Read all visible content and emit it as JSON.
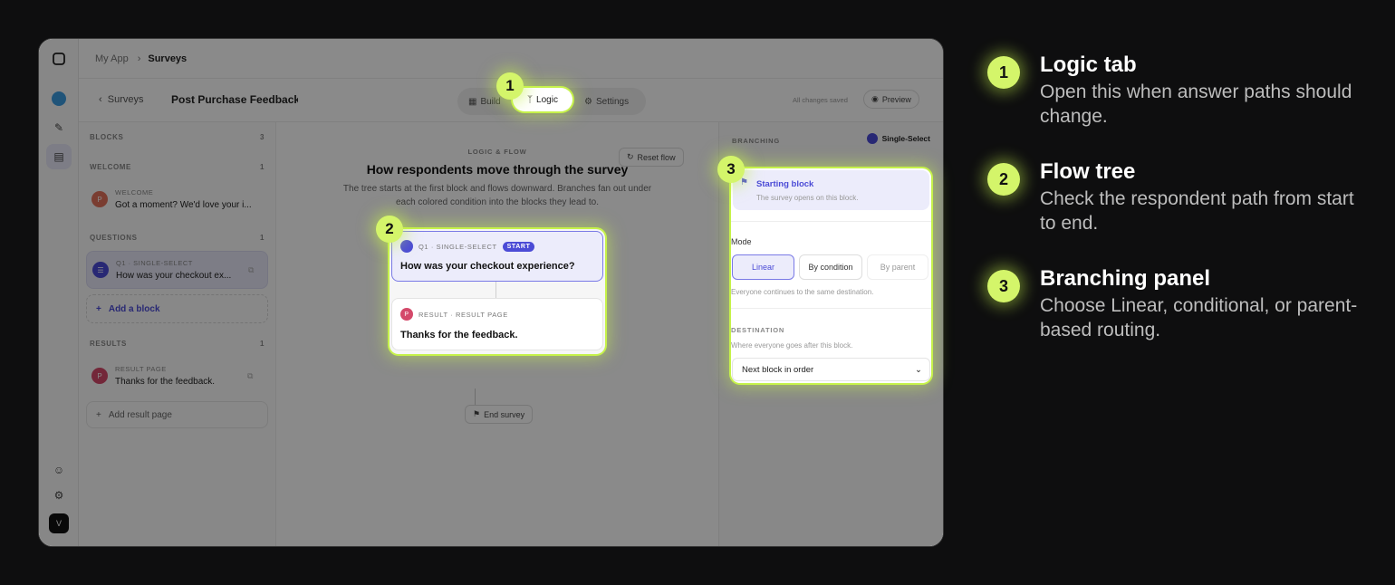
{
  "topbar": {
    "app": "My App",
    "page": "Surveys"
  },
  "subbar": {
    "back": "Surveys",
    "title": "Post Purchase Feedback S",
    "saved": "All changes saved",
    "preview": "Preview"
  },
  "tabs": {
    "build": "Build",
    "logic": "Logic",
    "settings": "Settings"
  },
  "left": {
    "blocks": {
      "label": "BLOCKS",
      "count": "3"
    },
    "welcome": {
      "label": "WELCOME",
      "count": "1",
      "item_tag": "WELCOME",
      "item_text": "Got a moment? We'd love your i..."
    },
    "questions": {
      "label": "QUESTIONS",
      "count": "1",
      "item_tag": "Q1 · SINGLE-SELECT",
      "item_text": "How was your checkout ex..."
    },
    "add_block": "Add a block",
    "results": {
      "label": "RESULTS",
      "count": "1",
      "item_tag": "RESULT PAGE",
      "item_text": "Thanks for the feedback."
    },
    "add_result": "Add result page"
  },
  "center": {
    "eyebrow": "LOGIC & FLOW",
    "reset": "Reset flow",
    "title": "How respondents move through the survey",
    "desc": "The tree starts at the first block and flows downward. Branches fan out under each colored condition into the blocks they lead to.",
    "q_tag": "Q1 · SINGLE-SELECT",
    "q_start": "START",
    "q_text": "How was your checkout experience?",
    "r_tag": "RESULT · RESULT PAGE",
    "r_text": "Thanks for the feedback.",
    "end": "End survey"
  },
  "right": {
    "branching": "BRANCHING",
    "type": "Single-Select",
    "starting": "Starting block",
    "starting_sub": "The survey opens on this block.",
    "mode": "Mode",
    "modes": [
      "Linear",
      "By condition",
      "By parent"
    ],
    "mode_hint": "Everyone continues to the same destination.",
    "destination": "DESTINATION",
    "dest_hint": "Where everyone goes after this block.",
    "dest_value": "Next block in order"
  },
  "rail": {
    "avatar": "V"
  },
  "callouts": [
    "1",
    "2",
    "3"
  ],
  "legend": [
    {
      "num": "1",
      "title": "Logic tab",
      "text": "Open this when answer paths should change."
    },
    {
      "num": "2",
      "title": "Flow tree",
      "text": "Check the respondent path from start to end."
    },
    {
      "num": "3",
      "title": "Branching panel",
      "text": "Choose Linear, conditional, or parent-based routing."
    }
  ],
  "colors": {
    "accent": "#c6f24a",
    "brand": "#4b4bd6",
    "background": "#0e0e0f"
  }
}
